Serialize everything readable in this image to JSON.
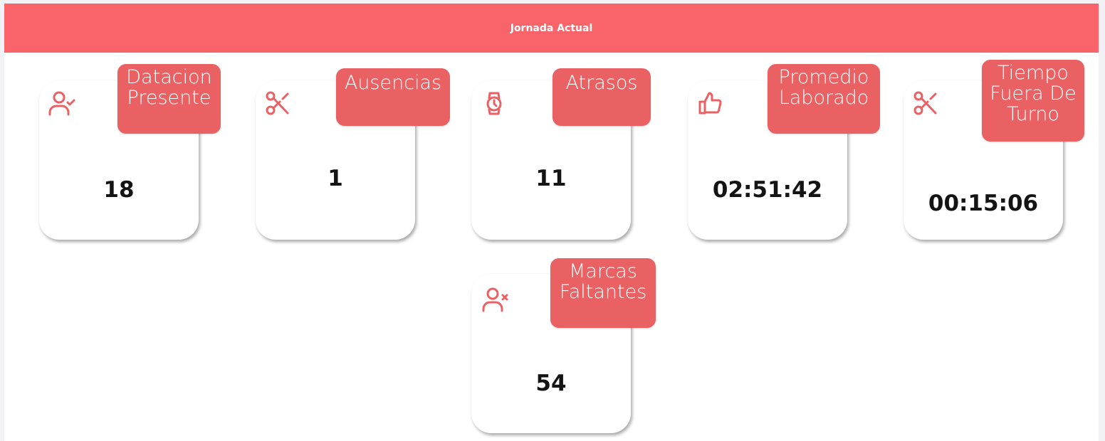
{
  "header": {
    "title": "Jornada Actual"
  },
  "colors": {
    "accent": "#f9646b",
    "tag": "#ea6164"
  },
  "cards": [
    {
      "title": "Datacion Presente",
      "value": "18",
      "icon": "user-check-icon"
    },
    {
      "title": "Ausencias",
      "value": "1",
      "icon": "scissors-icon"
    },
    {
      "title": "Atrasos",
      "value": "11",
      "icon": "watch-icon"
    },
    {
      "title": "Promedio Laborado",
      "value": "02:51:42",
      "icon": "thumbs-up-icon"
    },
    {
      "title": "Tiempo Fuera De Turno",
      "value": "00:15:06",
      "icon": "scissors-icon"
    },
    {
      "title": "Marcas Faltantes",
      "value": "54",
      "icon": "user-x-icon"
    }
  ]
}
